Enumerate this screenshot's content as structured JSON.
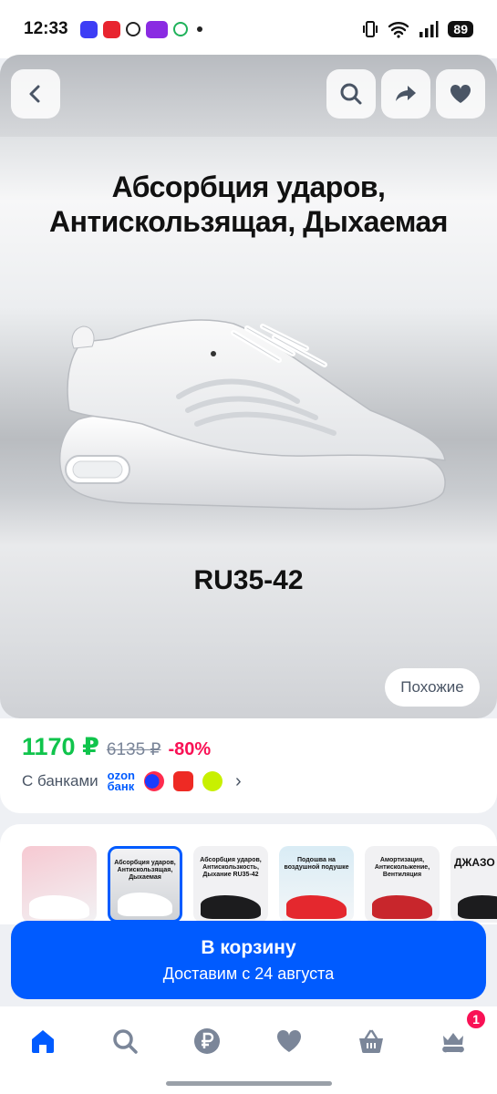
{
  "status_bar": {
    "time": "12:33",
    "battery": "89"
  },
  "gallery": {
    "promo_title_line1": "Абсорбция ударов,",
    "promo_title_line2": "Антискользящая, Дыхаемая",
    "size_text": "RU35-42",
    "similar_label": "Похожие"
  },
  "price": {
    "current": "1170 ₽",
    "old": "6135 ₽",
    "discount": "-80%",
    "banks_label": "С банками",
    "ozon_bank_line1": "ozon",
    "ozon_bank_line2": "банк"
  },
  "thumbnails": [
    {
      "caption": ""
    },
    {
      "caption": "Абсорбция ударов, Антискользящая, Дыхаемая"
    },
    {
      "caption": "Абсорбция ударов, Антискользкость, Дыхание RU35-42"
    },
    {
      "caption": "Подошва на воздушной подушке"
    },
    {
      "caption": "Амортизация, Антискольжение, Вентиляция"
    },
    {
      "caption": "ДЖАЗО"
    }
  ],
  "cart": {
    "title": "В корзину",
    "subtitle": "Доставим с 24 августа"
  },
  "nav": {
    "cart_badge": "1"
  },
  "colors": {
    "accent": "#005bff",
    "price_green": "#10c44c",
    "discount_pink": "#f91155"
  }
}
